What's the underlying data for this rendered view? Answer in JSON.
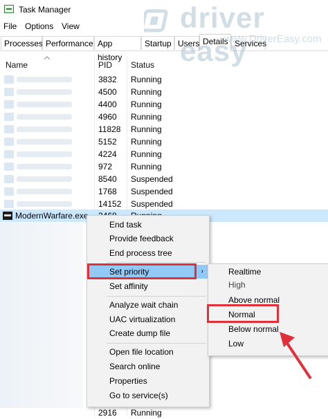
{
  "window": {
    "title": "Task Manager"
  },
  "menu": [
    "File",
    "Options",
    "View"
  ],
  "tabs": [
    "Processes",
    "Performance",
    "App history",
    "Startup",
    "Users",
    "Details",
    "Services"
  ],
  "active_tab": "Details",
  "columns": {
    "name": "Name",
    "pid": "PID",
    "status": "Status"
  },
  "rows": [
    {
      "pid": "3832",
      "status": "Running"
    },
    {
      "pid": "4500",
      "status": "Running"
    },
    {
      "pid": "4400",
      "status": "Running"
    },
    {
      "pid": "4960",
      "status": "Running"
    },
    {
      "pid": "11828",
      "status": "Running"
    },
    {
      "pid": "5152",
      "status": "Running"
    },
    {
      "pid": "4224",
      "status": "Running"
    },
    {
      "pid": "972",
      "status": "Running"
    },
    {
      "pid": "8540",
      "status": "Suspended"
    },
    {
      "pid": "1768",
      "status": "Suspended"
    },
    {
      "pid": "14152",
      "status": "Suspended"
    }
  ],
  "selected_row": {
    "name": "ModernWarfare.exe",
    "pid": "2468",
    "status": "Running"
  },
  "bottom_row": {
    "pid": "2916",
    "status": "Running"
  },
  "context_menu": {
    "items": [
      "End task",
      "Provide feedback",
      "End process tree",
      "Set priority",
      "Set affinity",
      "Analyze wait chain",
      "UAC virtualization",
      "Create dump file",
      "Open file location",
      "Search online",
      "Properties",
      "Go to service(s)"
    ],
    "highlighted": "Set priority"
  },
  "submenu": {
    "items": [
      "Realtime",
      "High",
      "Above normal",
      "Normal",
      "Below normal",
      "Low"
    ],
    "selected": "Normal"
  },
  "watermark": {
    "brand": "driver easy",
    "url": "www.DriverEasy.com"
  },
  "colors": {
    "highlight": "#91c9f7",
    "selected_row": "#cce8ff",
    "annotation_red": "#e0313b"
  }
}
